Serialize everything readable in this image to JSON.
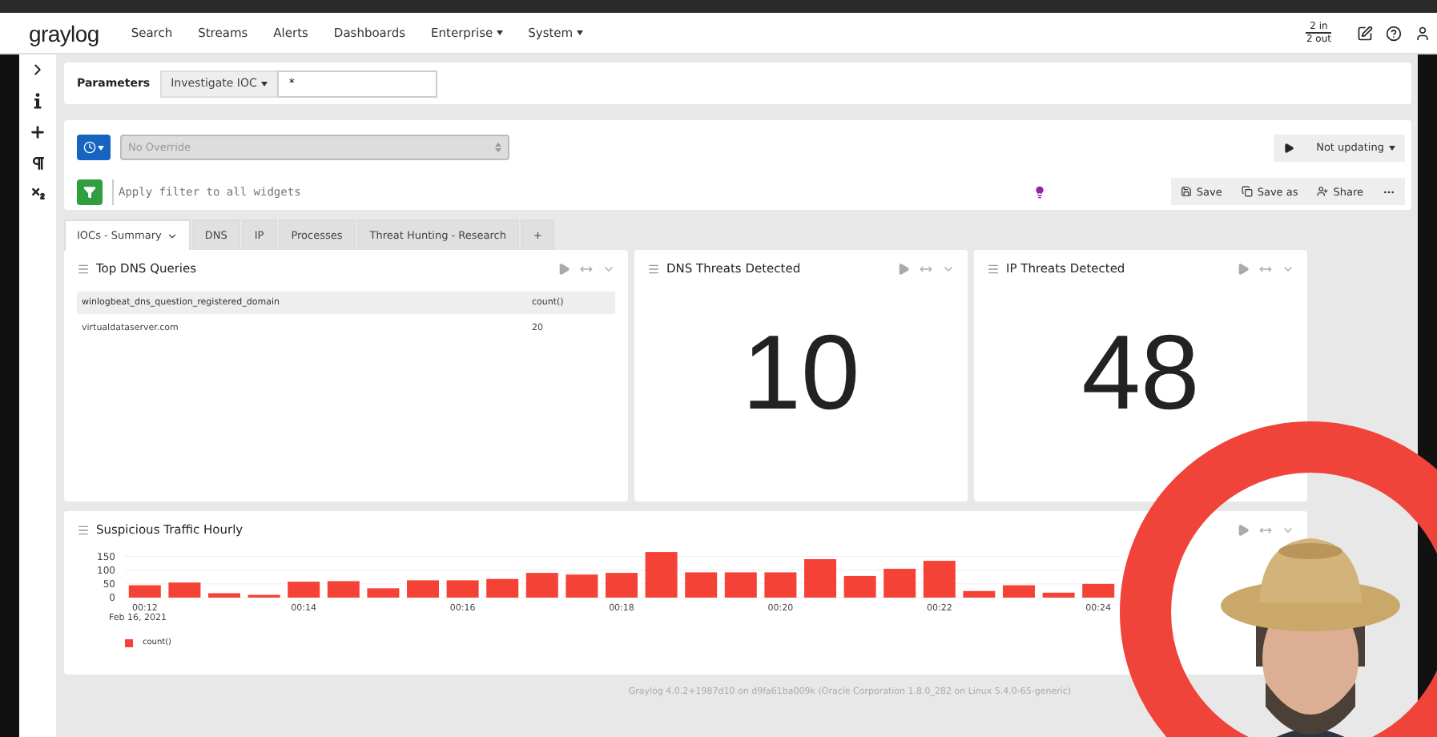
{
  "navbar": {
    "logo": "graylog",
    "items": [
      {
        "label": "Search",
        "dropdown": false
      },
      {
        "label": "Streams",
        "dropdown": false
      },
      {
        "label": "Alerts",
        "dropdown": false
      },
      {
        "label": "Dashboards",
        "dropdown": false
      },
      {
        "label": "Enterprise",
        "dropdown": true
      },
      {
        "label": "System",
        "dropdown": true
      }
    ],
    "throughput_in": "2 in",
    "throughput_out": "2 out"
  },
  "parameters": {
    "label": "Parameters",
    "parameter": "Investigate IOC",
    "value": "*"
  },
  "query": {
    "timerange": "No Override",
    "filter_placeholder": "Apply filter to all widgets",
    "refresh": "Not updating",
    "actions": [
      {
        "kind": "save",
        "label": "Save"
      },
      {
        "kind": "saveas",
        "label": "Save as"
      },
      {
        "kind": "share",
        "label": "Share"
      }
    ]
  },
  "tabs": [
    {
      "label": "IOCs - Summary",
      "selected": true
    },
    {
      "label": "DNS",
      "selected": false
    },
    {
      "label": "IP",
      "selected": false
    },
    {
      "label": "Processes",
      "selected": false
    },
    {
      "label": "Threat Hunting - Research",
      "selected": false
    },
    {
      "label": "+",
      "selected": false
    }
  ],
  "widgets": [
    {
      "kind": "table",
      "title": "Top DNS Queries",
      "columns": [
        "winlogbeat_dns_question_registered_domain",
        "count()"
      ],
      "rows": [
        [
          "virtualdataserver.com",
          "20"
        ]
      ]
    },
    {
      "kind": "number",
      "title": "DNS Threats Detected",
      "value": "10"
    },
    {
      "kind": "number",
      "title": "IP Threats Detected",
      "value": "48"
    }
  ],
  "chart_widget": {
    "title": "Suspicious Traffic Hourly",
    "date_label": "Feb 16, 2021",
    "chart_data": {
      "type": "bar",
      "x": [
        12,
        12.5,
        13,
        13.5,
        14,
        14.5,
        15,
        15.5,
        16,
        16.5,
        17,
        17.5,
        18,
        18.5,
        19,
        19.5,
        20,
        20.5,
        21,
        21.5,
        22,
        22.5,
        23,
        23.5,
        24
      ],
      "series": [
        {
          "name": "count()",
          "color": "#f44336",
          "values": [
            45,
            55,
            16,
            10,
            58,
            60,
            34,
            63,
            63,
            68,
            90,
            84,
            90,
            166,
            92,
            92,
            92,
            140,
            79,
            105,
            134,
            24,
            45,
            18,
            50
          ]
        }
      ],
      "xlim": [
        11.75,
        24.25
      ],
      "ylim": [
        0,
        175
      ],
      "grid": true,
      "yticks": [
        0,
        50,
        100,
        150
      ],
      "xticks": [
        {
          "value": 12,
          "label": "00:12"
        },
        {
          "value": 14,
          "label": "00:14"
        },
        {
          "value": 16,
          "label": "00:16"
        },
        {
          "value": 18,
          "label": "00:18"
        },
        {
          "value": 20,
          "label": "00:20"
        },
        {
          "value": 22,
          "label": "00:22"
        },
        {
          "value": 24,
          "label": "00:24"
        }
      ]
    }
  },
  "footer": "Graylog 4.0.2+1987d10 on d9fa61ba009k (Oracle Corporation 1.8.0_282 on Linux 5.4.0-65-generic)"
}
